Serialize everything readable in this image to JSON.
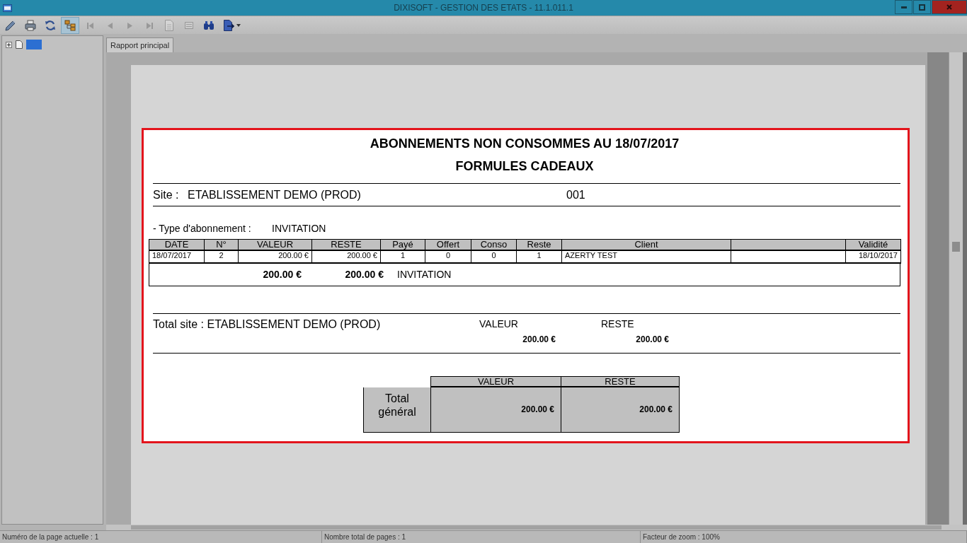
{
  "window": {
    "title": "DIXISOFT - GESTION DES ETATS - 11.1.011.1"
  },
  "toolbar": [
    {
      "selected": false,
      "disabled": false,
      "dropdown": false
    },
    {
      "selected": false,
      "disabled": false,
      "dropdown": false
    },
    {
      "selected": false,
      "disabled": false,
      "dropdown": false
    },
    {
      "selected": true,
      "disabled": false,
      "dropdown": false
    },
    {
      "selected": false,
      "disabled": true,
      "dropdown": false
    },
    {
      "selected": false,
      "disabled": true,
      "dropdown": false
    },
    {
      "selected": false,
      "disabled": true,
      "dropdown": false
    },
    {
      "selected": false,
      "disabled": true,
      "dropdown": false
    },
    {
      "selected": false,
      "disabled": true,
      "dropdown": false
    },
    {
      "selected": false,
      "disabled": true,
      "dropdown": false
    },
    {
      "selected": false,
      "disabled": false,
      "dropdown": false
    },
    {
      "selected": false,
      "disabled": false,
      "dropdown": true
    }
  ],
  "tree": [
    {
      "expanded": false,
      "selected": true
    }
  ],
  "tabs": [
    {
      "label": "Rapport principal",
      "selected": true
    }
  ],
  "report": {
    "title": "ABONNEMENTS NON CONSOMMES AU 18/07/2017",
    "subtitle": "FORMULES CADEAUX",
    "site": {
      "label": "Site :",
      "name": "ETABLISSEMENT DEMO (PROD)",
      "code": "001"
    },
    "subscription_type": {
      "label": "- Type d'abonnement :",
      "value": "INVITATION"
    },
    "table": {
      "columns": [
        {
          "kind": "heading",
          "label": "DATE"
        },
        {
          "kind": "heading",
          "label": "N°"
        },
        {
          "kind": "heading",
          "label": "VALEUR"
        },
        {
          "kind": "heading",
          "label": "RESTE"
        },
        {
          "kind": "heading",
          "label": "Payé"
        },
        {
          "kind": "heading",
          "label": "Offert"
        },
        {
          "kind": "heading",
          "label": "Conso"
        },
        {
          "kind": "heading",
          "label": "Reste"
        },
        {
          "kind": "heading",
          "label": "Client"
        },
        {
          "kind": "blank"
        },
        {
          "kind": "heading",
          "label": "Validité"
        }
      ],
      "rows": [
        {
          "cells": [
            "18/07/2017",
            "2",
            "200.00 €",
            "200.00 €",
            "1",
            "0",
            "0",
            "1",
            "AZERTY TEST",
            "18/10/2017"
          ]
        }
      ]
    },
    "group_total": {
      "valeur": "200.00 €",
      "reste": "200.00 €",
      "type": "INVITATION"
    },
    "site_total": {
      "label": "Total site : ETABLISSEMENT DEMO (PROD)",
      "columns": [
        {
          "heading": "VALEUR",
          "value": "200.00 €"
        },
        {
          "heading": "RESTE",
          "value": "200.00 €"
        }
      ]
    },
    "grand_total": {
      "label": "Total général",
      "columns": [
        {
          "heading": "VALEUR",
          "value": "200.00 €"
        },
        {
          "heading": "RESTE",
          "value": "200.00 €"
        }
      ]
    }
  },
  "status_bar": [
    "Numéro de la page actuelle : 1",
    "Nombre total de pages : 1",
    "Facteur de zoom : 100%"
  ]
}
